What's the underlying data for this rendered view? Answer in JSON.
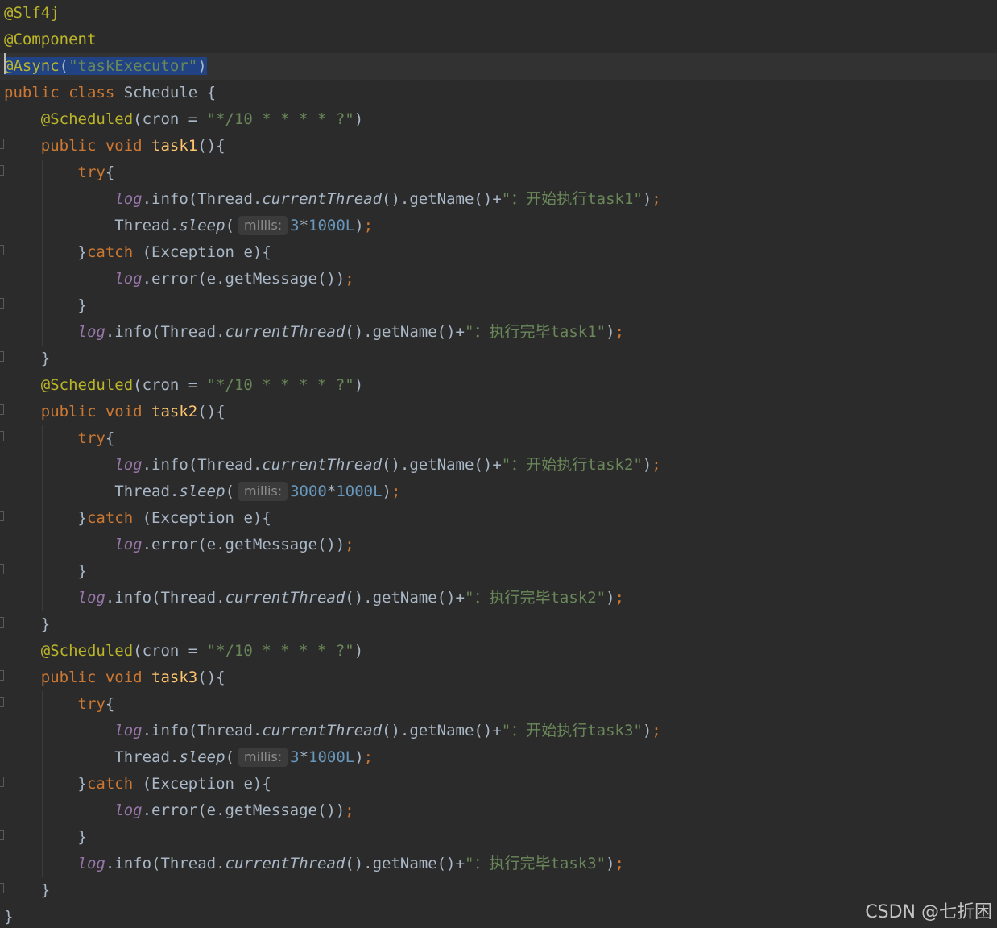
{
  "editor": {
    "colors": {
      "background": "#2b2b2b",
      "annotation": "#bbb529",
      "keyword": "#cc7832",
      "method": "#ffc66d",
      "string": "#6a8759",
      "number": "#6897bb",
      "field": "#9876aa",
      "text": "#a9b7c6",
      "selection": "#214283"
    },
    "lines": [
      {
        "tokens": [
          {
            "t": "@Slf4j",
            "c": "ann"
          }
        ]
      },
      {
        "tokens": [
          {
            "t": "@Component",
            "c": "ann"
          }
        ]
      },
      {
        "current": true,
        "tokens": [
          {
            "t": "@Async",
            "c": "ann",
            "sel": true
          },
          {
            "t": "(",
            "c": "plain",
            "sel": true
          },
          {
            "t": "\"taskExecutor\"",
            "c": "str",
            "sel": true
          },
          {
            "t": ")",
            "c": "plain",
            "sel": true
          }
        ]
      },
      {
        "tokens": [
          {
            "t": "public class ",
            "c": "kw"
          },
          {
            "t": "Schedule {",
            "c": "plain"
          }
        ]
      },
      {
        "tokens": [
          {
            "t": "    ",
            "c": "plain"
          },
          {
            "t": "@Scheduled",
            "c": "ann"
          },
          {
            "t": "(cron = ",
            "c": "plain"
          },
          {
            "t": "\"*/10 * * * * ?\"",
            "c": "str"
          },
          {
            "t": ")",
            "c": "plain"
          }
        ]
      },
      {
        "tokens": [
          {
            "t": "    ",
            "c": "plain"
          },
          {
            "t": "public void ",
            "c": "kw"
          },
          {
            "t": "task1",
            "c": "fn"
          },
          {
            "t": "(){",
            "c": "plain"
          }
        ]
      },
      {
        "tokens": [
          {
            "t": "        ",
            "c": "plain"
          },
          {
            "t": "try",
            "c": "kw"
          },
          {
            "t": "{",
            "c": "plain"
          }
        ]
      },
      {
        "tokens": [
          {
            "t": "            ",
            "c": "plain"
          },
          {
            "t": "log",
            "c": "field"
          },
          {
            "t": ".info(Thread.",
            "c": "plain"
          },
          {
            "t": "currentThread",
            "c": "static"
          },
          {
            "t": "().getName()+",
            "c": "plain"
          },
          {
            "t": "\"：开始执行task1\"",
            "c": "str"
          },
          {
            "t": ")",
            "c": "plain"
          },
          {
            "t": ";",
            "c": "kw"
          }
        ]
      },
      {
        "tokens": [
          {
            "t": "            ",
            "c": "plain"
          },
          {
            "t": "Thread.",
            "c": "plain"
          },
          {
            "t": "sleep",
            "c": "static"
          },
          {
            "t": "(",
            "c": "plain"
          },
          {
            "t": "millis:",
            "c": "hint"
          },
          {
            "t": "3",
            "c": "num"
          },
          {
            "t": "*",
            "c": "plain"
          },
          {
            "t": "1000L",
            "c": "num"
          },
          {
            "t": ")",
            "c": "plain"
          },
          {
            "t": ";",
            "c": "kw"
          }
        ]
      },
      {
        "tokens": [
          {
            "t": "        ",
            "c": "plain"
          },
          {
            "t": "}",
            "c": "plain"
          },
          {
            "t": "catch ",
            "c": "kw"
          },
          {
            "t": "(Exception e){",
            "c": "plain"
          }
        ]
      },
      {
        "tokens": [
          {
            "t": "            ",
            "c": "plain"
          },
          {
            "t": "log",
            "c": "field"
          },
          {
            "t": ".error(e.getMessage())",
            "c": "plain"
          },
          {
            "t": ";",
            "c": "kw"
          }
        ]
      },
      {
        "tokens": [
          {
            "t": "        ",
            "c": "plain"
          },
          {
            "t": "}",
            "c": "plain"
          }
        ]
      },
      {
        "tokens": [
          {
            "t": "        ",
            "c": "plain"
          },
          {
            "t": "log",
            "c": "field"
          },
          {
            "t": ".info(Thread.",
            "c": "plain"
          },
          {
            "t": "currentThread",
            "c": "static"
          },
          {
            "t": "().getName()+",
            "c": "plain"
          },
          {
            "t": "\"：执行完毕task1\"",
            "c": "str"
          },
          {
            "t": ")",
            "c": "plain"
          },
          {
            "t": ";",
            "c": "kw"
          }
        ]
      },
      {
        "tokens": [
          {
            "t": "    ",
            "c": "plain"
          },
          {
            "t": "}",
            "c": "plain"
          }
        ]
      },
      {
        "tokens": [
          {
            "t": "    ",
            "c": "plain"
          },
          {
            "t": "@Scheduled",
            "c": "ann"
          },
          {
            "t": "(cron = ",
            "c": "plain"
          },
          {
            "t": "\"*/10 * * * * ?\"",
            "c": "str"
          },
          {
            "t": ")",
            "c": "plain"
          }
        ]
      },
      {
        "tokens": [
          {
            "t": "    ",
            "c": "plain"
          },
          {
            "t": "public void ",
            "c": "kw"
          },
          {
            "t": "task2",
            "c": "fn"
          },
          {
            "t": "(){",
            "c": "plain"
          }
        ]
      },
      {
        "tokens": [
          {
            "t": "        ",
            "c": "plain"
          },
          {
            "t": "try",
            "c": "kw"
          },
          {
            "t": "{",
            "c": "plain"
          }
        ]
      },
      {
        "tokens": [
          {
            "t": "            ",
            "c": "plain"
          },
          {
            "t": "log",
            "c": "field"
          },
          {
            "t": ".info(Thread.",
            "c": "plain"
          },
          {
            "t": "currentThread",
            "c": "static"
          },
          {
            "t": "().getName()+",
            "c": "plain"
          },
          {
            "t": "\"：开始执行task2\"",
            "c": "str"
          },
          {
            "t": ")",
            "c": "plain"
          },
          {
            "t": ";",
            "c": "kw"
          }
        ]
      },
      {
        "tokens": [
          {
            "t": "            ",
            "c": "plain"
          },
          {
            "t": "Thread.",
            "c": "plain"
          },
          {
            "t": "sleep",
            "c": "static"
          },
          {
            "t": "(",
            "c": "plain"
          },
          {
            "t": "millis:",
            "c": "hint"
          },
          {
            "t": "3000",
            "c": "num"
          },
          {
            "t": "*",
            "c": "plain"
          },
          {
            "t": "1000L",
            "c": "num"
          },
          {
            "t": ")",
            "c": "plain"
          },
          {
            "t": ";",
            "c": "kw"
          }
        ]
      },
      {
        "tokens": [
          {
            "t": "        ",
            "c": "plain"
          },
          {
            "t": "}",
            "c": "plain"
          },
          {
            "t": "catch ",
            "c": "kw"
          },
          {
            "t": "(Exception e){",
            "c": "plain"
          }
        ]
      },
      {
        "tokens": [
          {
            "t": "            ",
            "c": "plain"
          },
          {
            "t": "log",
            "c": "field"
          },
          {
            "t": ".error(e.getMessage())",
            "c": "plain"
          },
          {
            "t": ";",
            "c": "kw"
          }
        ]
      },
      {
        "tokens": [
          {
            "t": "        ",
            "c": "plain"
          },
          {
            "t": "}",
            "c": "plain"
          }
        ]
      },
      {
        "tokens": [
          {
            "t": "        ",
            "c": "plain"
          },
          {
            "t": "log",
            "c": "field"
          },
          {
            "t": ".info(Thread.",
            "c": "plain"
          },
          {
            "t": "currentThread",
            "c": "static"
          },
          {
            "t": "().getName()+",
            "c": "plain"
          },
          {
            "t": "\"：执行完毕task2\"",
            "c": "str"
          },
          {
            "t": ")",
            "c": "plain"
          },
          {
            "t": ";",
            "c": "kw"
          }
        ]
      },
      {
        "tokens": [
          {
            "t": "    ",
            "c": "plain"
          },
          {
            "t": "}",
            "c": "plain"
          }
        ]
      },
      {
        "tokens": [
          {
            "t": "    ",
            "c": "plain"
          },
          {
            "t": "@Scheduled",
            "c": "ann"
          },
          {
            "t": "(cron = ",
            "c": "plain"
          },
          {
            "t": "\"*/10 * * * * ?\"",
            "c": "str"
          },
          {
            "t": ")",
            "c": "plain"
          }
        ]
      },
      {
        "tokens": [
          {
            "t": "    ",
            "c": "plain"
          },
          {
            "t": "public void ",
            "c": "kw"
          },
          {
            "t": "task3",
            "c": "fn"
          },
          {
            "t": "(){",
            "c": "plain"
          }
        ]
      },
      {
        "tokens": [
          {
            "t": "        ",
            "c": "plain"
          },
          {
            "t": "try",
            "c": "kw"
          },
          {
            "t": "{",
            "c": "plain"
          }
        ]
      },
      {
        "tokens": [
          {
            "t": "            ",
            "c": "plain"
          },
          {
            "t": "log",
            "c": "field"
          },
          {
            "t": ".info(Thread.",
            "c": "plain"
          },
          {
            "t": "currentThread",
            "c": "static"
          },
          {
            "t": "().getName()+",
            "c": "plain"
          },
          {
            "t": "\"：开始执行task3\"",
            "c": "str"
          },
          {
            "t": ")",
            "c": "plain"
          },
          {
            "t": ";",
            "c": "kw"
          }
        ]
      },
      {
        "tokens": [
          {
            "t": "            ",
            "c": "plain"
          },
          {
            "t": "Thread.",
            "c": "plain"
          },
          {
            "t": "sleep",
            "c": "static"
          },
          {
            "t": "(",
            "c": "plain"
          },
          {
            "t": "millis:",
            "c": "hint"
          },
          {
            "t": "3",
            "c": "num"
          },
          {
            "t": "*",
            "c": "plain"
          },
          {
            "t": "1000L",
            "c": "num"
          },
          {
            "t": ")",
            "c": "plain"
          },
          {
            "t": ";",
            "c": "kw"
          }
        ]
      },
      {
        "tokens": [
          {
            "t": "        ",
            "c": "plain"
          },
          {
            "t": "}",
            "c": "plain"
          },
          {
            "t": "catch ",
            "c": "kw"
          },
          {
            "t": "(Exception e){",
            "c": "plain"
          }
        ]
      },
      {
        "tokens": [
          {
            "t": "            ",
            "c": "plain"
          },
          {
            "t": "log",
            "c": "field"
          },
          {
            "t": ".error(e.getMessage())",
            "c": "plain"
          },
          {
            "t": ";",
            "c": "kw"
          }
        ]
      },
      {
        "tokens": [
          {
            "t": "        ",
            "c": "plain"
          },
          {
            "t": "}",
            "c": "plain"
          }
        ]
      },
      {
        "tokens": [
          {
            "t": "        ",
            "c": "plain"
          },
          {
            "t": "log",
            "c": "field"
          },
          {
            "t": ".info(Thread.",
            "c": "plain"
          },
          {
            "t": "currentThread",
            "c": "static"
          },
          {
            "t": "().getName()+",
            "c": "plain"
          },
          {
            "t": "\"：执行完毕task3\"",
            "c": "str"
          },
          {
            "t": ")",
            "c": "plain"
          },
          {
            "t": ";",
            "c": "kw"
          }
        ]
      },
      {
        "tokens": [
          {
            "t": "    ",
            "c": "plain"
          },
          {
            "t": "}",
            "c": "plain"
          }
        ]
      },
      {
        "tokens": [
          {
            "t": "}",
            "c": "plain"
          }
        ]
      }
    ]
  },
  "watermark": "CSDN @七折困"
}
